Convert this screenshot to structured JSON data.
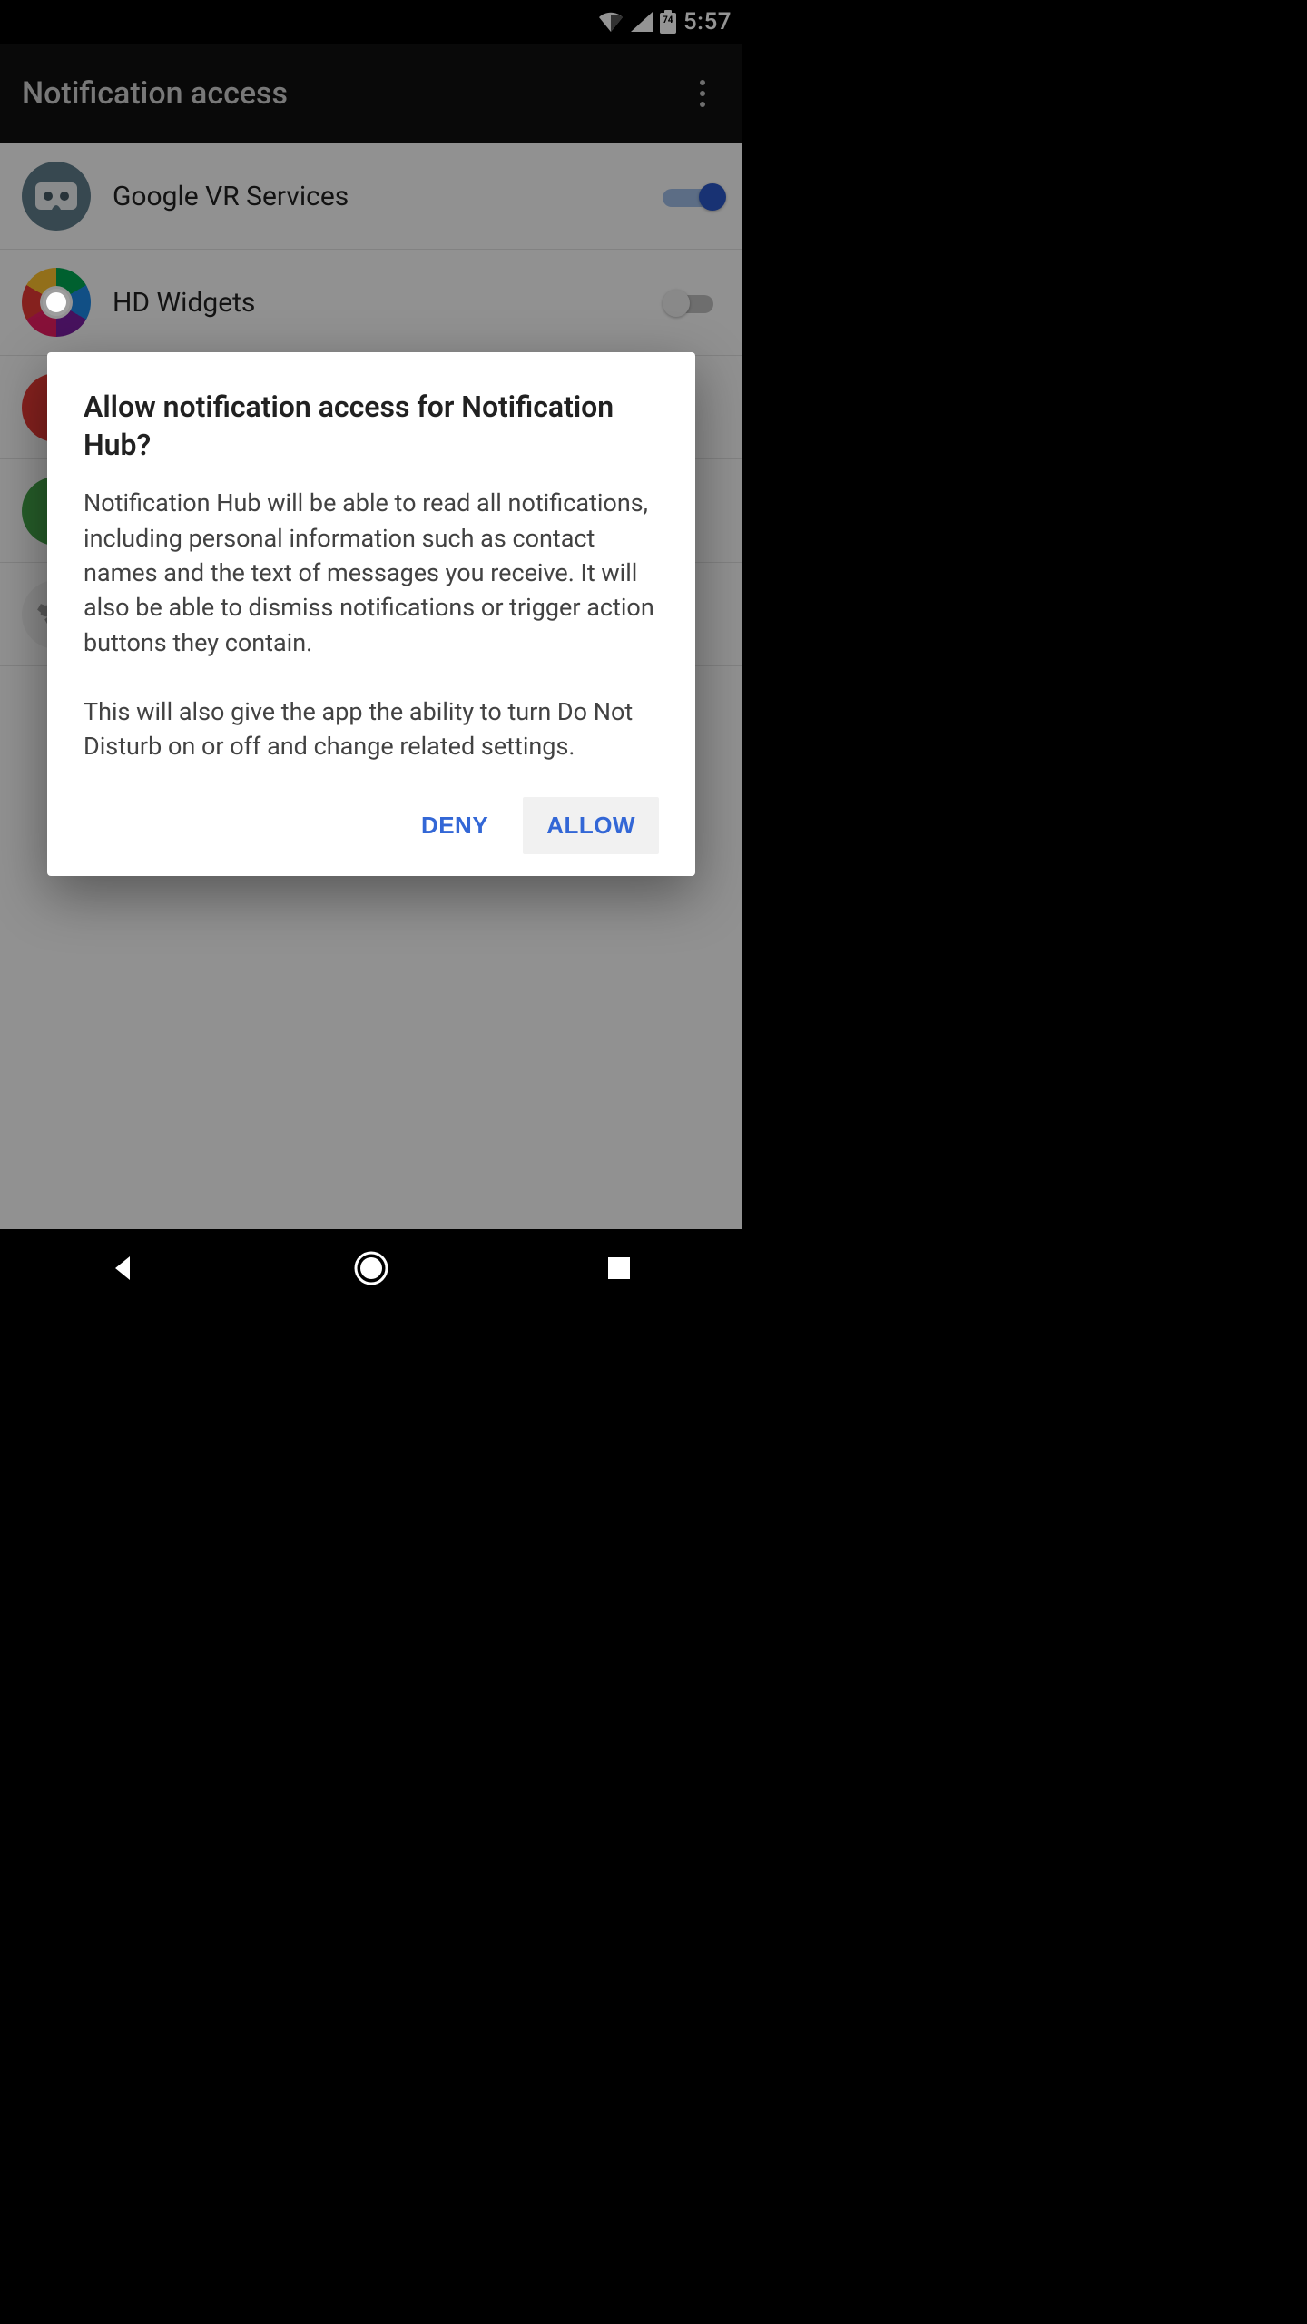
{
  "status": {
    "battery_level": "74",
    "time": "5:57"
  },
  "appbar": {
    "title": "Notification access"
  },
  "rows": [
    {
      "label": "Google VR Services",
      "enabled": true,
      "icon": "vr-icon"
    },
    {
      "label": "HD Widgets",
      "enabled": false,
      "icon": "hd-widgets-icon"
    }
  ],
  "dialog": {
    "title": "Allow notification access for Notification Hub?",
    "body": "Notification Hub will be able to read all notifications, including personal information such as contact names and the text of messages you receive. It will also be able to dismiss notifications or trigger action buttons they contain.\n\nThis will also give the app the ability to turn Do Not Disturb on or off and change related settings.",
    "deny_label": "DENY",
    "allow_label": "ALLOW"
  }
}
